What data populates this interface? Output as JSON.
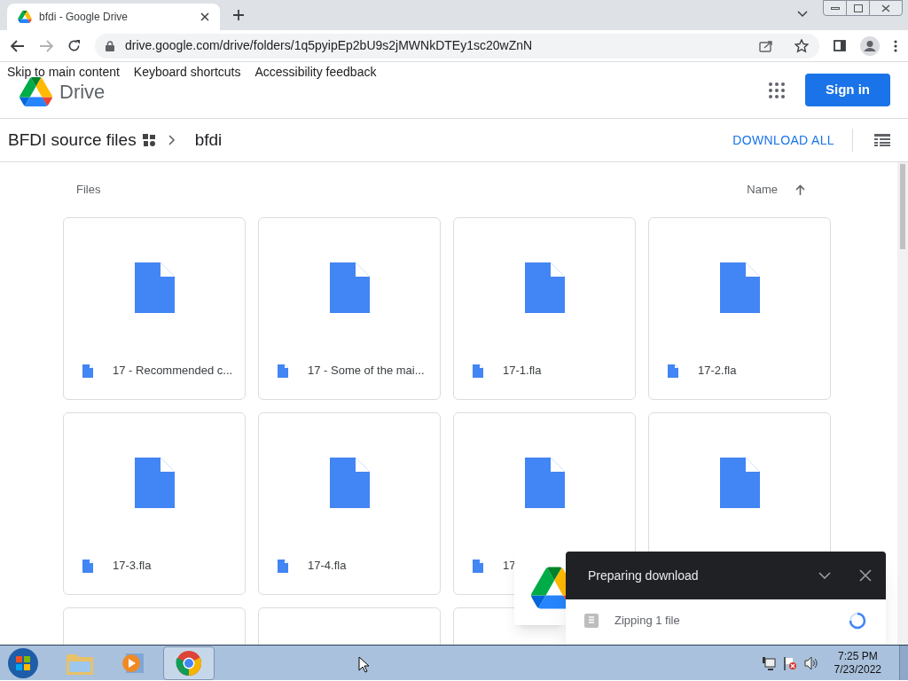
{
  "browser": {
    "tab_title": "bfdi - Google Drive",
    "url": "drive.google.com/drive/folders/1q5pyipEp2bU9s2jMWNkDTEy1sc20wZnN"
  },
  "skip_links": [
    "Skip to main content",
    "Keyboard shortcuts",
    "Accessibility feedback"
  ],
  "header": {
    "product": "Drive",
    "sign_in": "Sign in"
  },
  "breadcrumb": [
    "BFDI source files",
    "bfdi"
  ],
  "toolbar": {
    "download_all": "DOWNLOAD ALL"
  },
  "section": {
    "title": "Files",
    "sort": "Name"
  },
  "files": [
    {
      "kind": "labeled",
      "name": "17 - Recommended c..."
    },
    {
      "kind": "labeled",
      "name": "17 - Some of the mai..."
    },
    {
      "kind": "labeled",
      "name": "17-1.fla"
    },
    {
      "kind": "labeled",
      "name": "17-2.fla"
    },
    {
      "kind": "labeled",
      "name": "17-3.fla"
    },
    {
      "kind": "labeled",
      "name": "17-4.fla"
    },
    {
      "kind": "labeled",
      "name": "17"
    },
    {
      "kind": "unlabeled"
    },
    {
      "kind": "unlabeled"
    },
    {
      "kind": "unlabeled"
    },
    {
      "kind": "unlabeled"
    }
  ],
  "download_panel": {
    "title": "Preparing download",
    "item": "Zipping 1 file"
  },
  "clock": {
    "time": "7:25 PM",
    "date": "7/23/2022"
  }
}
